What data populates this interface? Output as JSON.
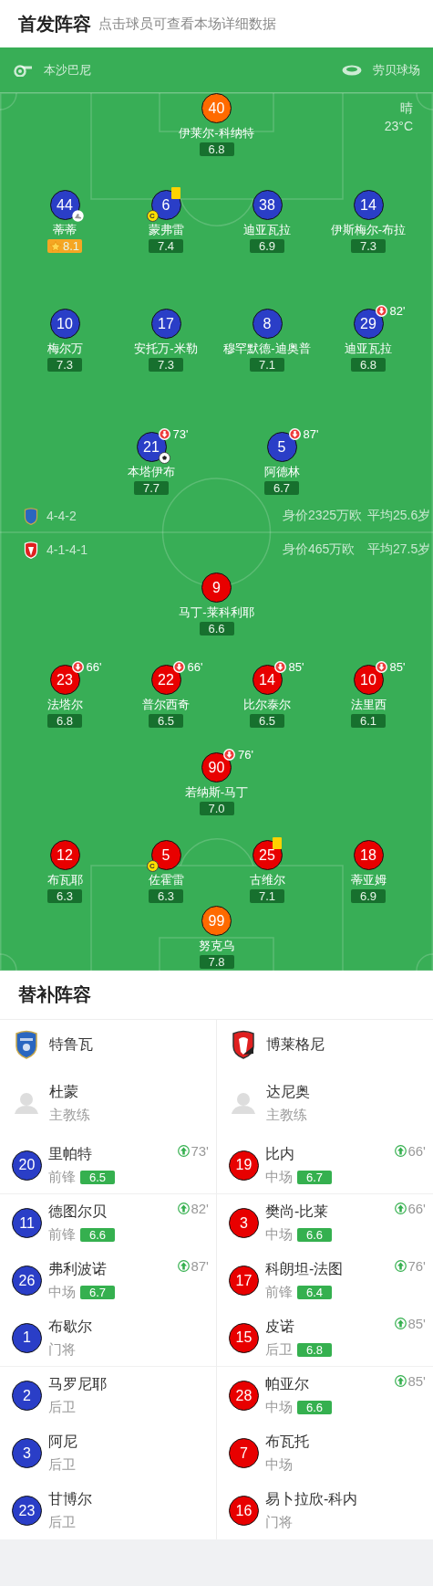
{
  "header": {
    "title": "首发阵容",
    "subtitle": "点击球员可查看本场详细数据"
  },
  "match_info": {
    "referee": "本沙巴尼",
    "stadium": "劳贝球场",
    "weather": "晴",
    "temperature": "23°C"
  },
  "teams": [
    {
      "kind": "home",
      "name": "特鲁瓦",
      "color": "#2a3ec7",
      "formation": "4-4-2",
      "value": "身价2325万欧",
      "average_age": "平均25.6岁",
      "lineup": [
        [
          {
            "number": "40",
            "name": "伊莱尔-科纳特",
            "rating": "6.8",
            "kind": "goalkeeper"
          }
        ],
        [
          {
            "number": "44",
            "name": "蒂蒂",
            "rating": "8.1",
            "kind": "outfield",
            "marks": [
              {
                "kind": "assist"
              },
              {
                "kind": "best"
              }
            ]
          },
          {
            "number": "6",
            "name": "蒙弗雷",
            "rating": "7.4",
            "kind": "outfield",
            "marks": [
              {
                "kind": "captain",
                "label": "C"
              },
              {
                "kind": "card"
              }
            ]
          },
          {
            "number": "38",
            "name": "迪亚瓦拉",
            "rating": "6.9",
            "kind": "outfield"
          },
          {
            "number": "14",
            "name": "伊斯梅尔-布拉",
            "rating": "7.3",
            "kind": "outfield"
          }
        ],
        [
          {
            "number": "10",
            "name": "梅尔万",
            "rating": "7.3",
            "kind": "outfield"
          },
          {
            "number": "17",
            "name": "安托万-米勒",
            "rating": "7.3",
            "kind": "outfield"
          },
          {
            "number": "8",
            "name": "穆罕默德-迪奥普",
            "rating": "7.1",
            "kind": "outfield"
          },
          {
            "number": "29",
            "name": "迪亚瓦拉",
            "rating": "6.8",
            "kind": "outfield",
            "marks": [
              {
                "kind": "sub_off",
                "minute": "82'"
              }
            ]
          }
        ],
        [
          {
            "number": "21",
            "name": "本塔伊布",
            "rating": "7.7",
            "kind": "outfield",
            "marks": [
              {
                "kind": "goal"
              },
              {
                "kind": "sub_off",
                "minute": "73'"
              }
            ]
          },
          {
            "number": "5",
            "name": "阿德林",
            "rating": "6.7",
            "kind": "outfield",
            "marks": [
              {
                "kind": "sub_off",
                "minute": "87'"
              }
            ]
          }
        ]
      ],
      "coach": {
        "name": "杜蒙",
        "role": "主教练"
      },
      "substitutes": [
        {
          "number": "20",
          "name": "里帕特",
          "position": "前锋",
          "rating": "6.5",
          "sub_on": "73'"
        },
        {
          "number": "11",
          "name": "德图尔贝",
          "position": "前锋",
          "rating": "6.6",
          "sub_on": "82'"
        },
        {
          "number": "26",
          "name": "弗利波诺",
          "position": "中场",
          "rating": "6.7",
          "sub_on": "87'"
        },
        {
          "number": "1",
          "name": "布歇尔",
          "position": "门将"
        },
        {
          "number": "2",
          "name": "马罗尼耶",
          "position": "后卫"
        },
        {
          "number": "3",
          "name": "阿尼",
          "position": "后卫"
        },
        {
          "number": "23",
          "name": "甘博尔",
          "position": "后卫"
        }
      ]
    },
    {
      "kind": "away",
      "name": "博莱格尼",
      "color": "#e80000",
      "formation": "4-1-4-1",
      "value": "身价465万欧",
      "average_age": "平均27.5岁",
      "lineup": [
        [
          {
            "number": "9",
            "name": "马丁-莱科利耶",
            "rating": "6.6",
            "kind": "outfield"
          }
        ],
        [
          {
            "number": "23",
            "name": "法塔尔",
            "rating": "6.8",
            "kind": "outfield",
            "marks": [
              {
                "kind": "sub_off",
                "minute": "66'"
              }
            ]
          },
          {
            "number": "22",
            "name": "普尔西奇",
            "rating": "6.5",
            "kind": "outfield",
            "marks": [
              {
                "kind": "sub_off",
                "minute": "66'"
              }
            ]
          },
          {
            "number": "14",
            "name": "比尔泰尔",
            "rating": "6.5",
            "kind": "outfield",
            "marks": [
              {
                "kind": "sub_off",
                "minute": "85'"
              }
            ]
          },
          {
            "number": "10",
            "name": "法里西",
            "rating": "6.1",
            "kind": "outfield",
            "marks": [
              {
                "kind": "sub_off",
                "minute": "85'"
              }
            ]
          }
        ],
        [
          {
            "number": "90",
            "name": "若纳斯-马丁",
            "rating": "7.0",
            "kind": "outfield",
            "marks": [
              {
                "kind": "sub_off",
                "minute": "76'"
              }
            ]
          }
        ],
        [
          {
            "number": "12",
            "name": "布瓦耶",
            "rating": "6.3",
            "kind": "outfield"
          },
          {
            "number": "5",
            "name": "佐霍雷",
            "rating": "6.3",
            "kind": "outfield",
            "marks": [
              {
                "kind": "captain",
                "label": "C"
              }
            ]
          },
          {
            "number": "25",
            "name": "古维尔",
            "rating": "7.1",
            "kind": "outfield",
            "marks": [
              {
                "kind": "card"
              }
            ]
          },
          {
            "number": "18",
            "name": "蒂亚姆",
            "rating": "6.9",
            "kind": "outfield"
          }
        ],
        [
          {
            "number": "99",
            "name": "努克乌",
            "rating": "7.8",
            "kind": "goalkeeper"
          }
        ]
      ],
      "coach": {
        "name": "达尼奥",
        "role": "主教练"
      },
      "substitutes": [
        {
          "number": "19",
          "name": "比内",
          "position": "中场",
          "rating": "6.7",
          "sub_on": "66'"
        },
        {
          "number": "3",
          "name": "樊尚-比莱",
          "position": "中场",
          "rating": "6.6",
          "sub_on": "66'"
        },
        {
          "number": "17",
          "name": "科朗坦-法图",
          "position": "前锋",
          "rating": "6.4",
          "sub_on": "76'"
        },
        {
          "number": "15",
          "name": "皮诺",
          "position": "后卫",
          "rating": "6.8",
          "sub_on": "85'"
        },
        {
          "number": "28",
          "name": "帕亚尔",
          "position": "中场",
          "rating": "6.6",
          "sub_on": "85'"
        },
        {
          "number": "7",
          "name": "布瓦托",
          "position": "中场"
        },
        {
          "number": "16",
          "name": "易卜拉欣-科内",
          "position": "门将"
        }
      ]
    }
  ],
  "substitutes_title": "替补阵容"
}
